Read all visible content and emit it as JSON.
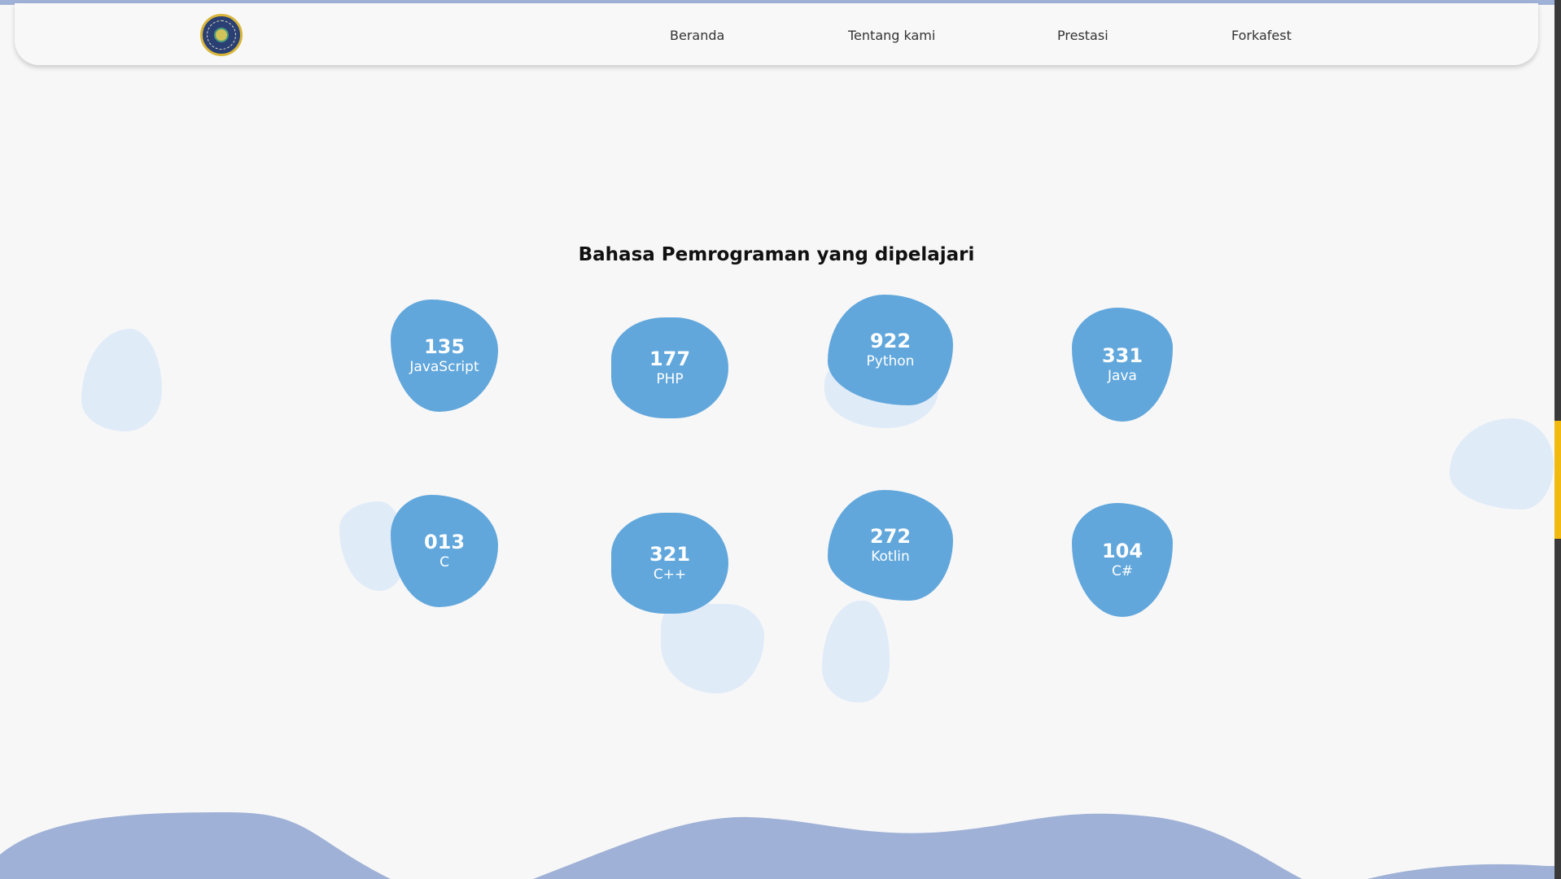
{
  "nav": {
    "logo_alt": "university-logo",
    "links": [
      {
        "label": "Beranda"
      },
      {
        "label": "Tentang kami"
      },
      {
        "label": "Prestasi"
      },
      {
        "label": "Forkafest"
      }
    ]
  },
  "section": {
    "title": "Bahasa Pemrograman yang dipelajari"
  },
  "languages": [
    {
      "count": "135",
      "name": "JavaScript"
    },
    {
      "count": "177",
      "name": "PHP"
    },
    {
      "count": "922",
      "name": "Python"
    },
    {
      "count": "331",
      "name": "Java"
    },
    {
      "count": "013",
      "name": "C"
    },
    {
      "count": "321",
      "name": "C++"
    },
    {
      "count": "272",
      "name": "Kotlin"
    },
    {
      "count": "104",
      "name": "C#"
    }
  ],
  "colors": {
    "blob": "#61a7dc",
    "deco_blob": "#dde9f7",
    "wave": "#9fb1d6",
    "scroll_thumb": "#f2b90f"
  }
}
